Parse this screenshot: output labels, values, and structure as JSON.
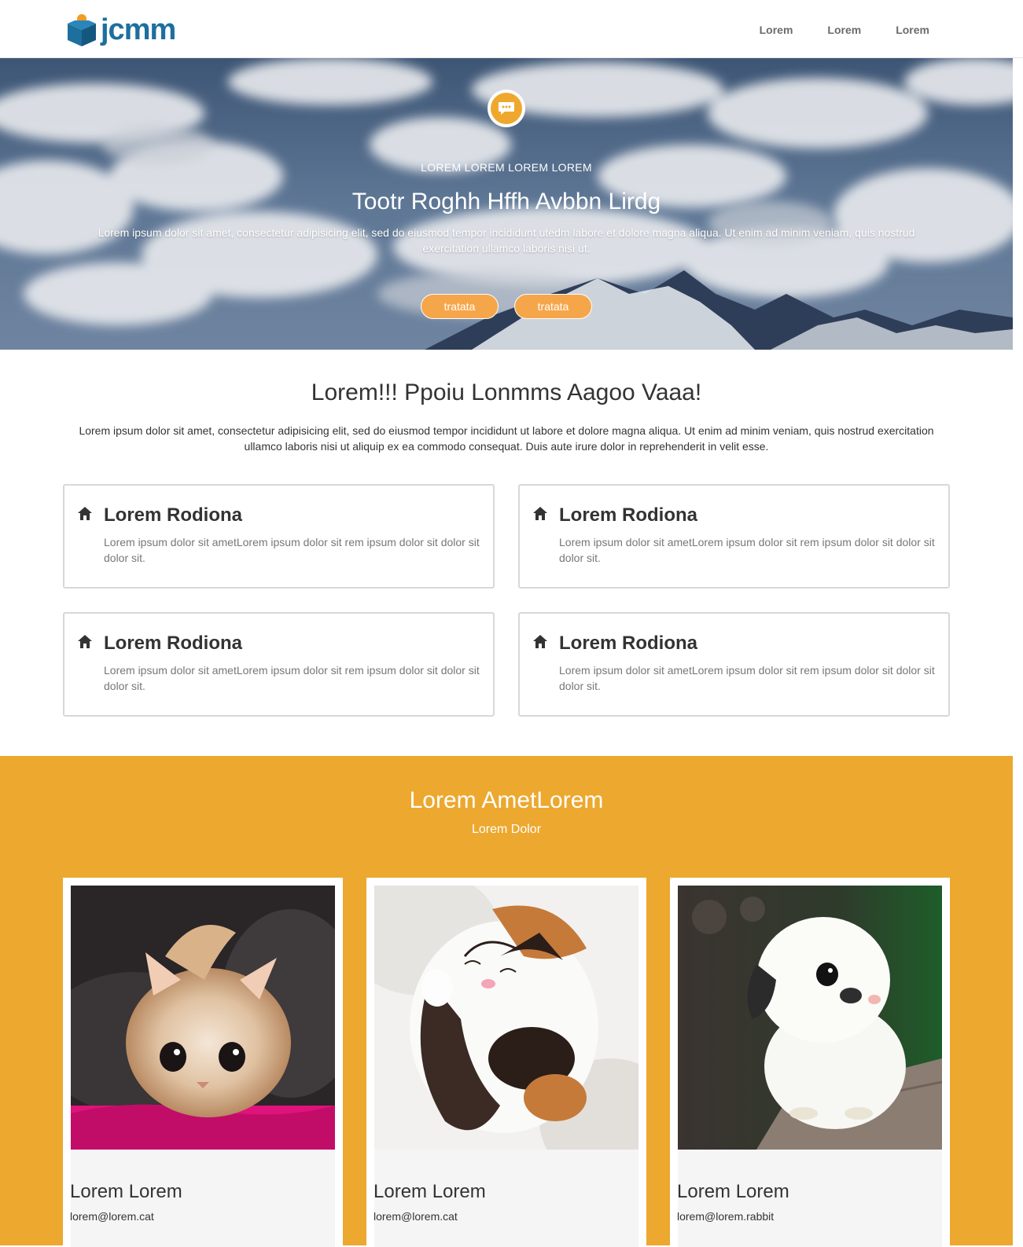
{
  "header": {
    "logo_text": "jcmm",
    "nav": [
      "Lorem",
      "Lorem",
      "Lorem"
    ]
  },
  "hero": {
    "kicker": "LOREM LOREM LOREM LOREM",
    "title": "Tootr Roghh Hffh Avbbn Lirdg",
    "text": "Lorem ipsum dolor sit amet, consectetur adipisicing elit, sed do eiusmod tempor incididunt utedm labore et dolore magna aliqua. Ut enim ad minim veniam, quis nostrud exercitation ullamco laboris nisi ut.",
    "buttons": [
      "tratata",
      "tratata"
    ],
    "icon": "chat-bubble-icon"
  },
  "intro": {
    "title": "Lorem!!! Ppoiu Lonmms Aagoo Vaaa!",
    "text": "Lorem ipsum dolor sit amet, consectetur adipisicing elit, sed do eiusmod tempor incididunt ut labore et dolore magna aliqua. Ut enim ad minim veniam, quis nostrud exercitation ullamco laboris nisi ut aliquip ex ea commodo consequat. Duis aute irure dolor in reprehenderit in velit esse."
  },
  "features": [
    {
      "title": "Lorem Rodiona",
      "text": "Lorem ipsum dolor sit ametLorem ipsum dolor sit rem ipsum dolor sit dolor sit dolor sit.",
      "icon": "home-icon"
    },
    {
      "title": "Lorem Rodiona",
      "text": "Lorem ipsum dolor sit ametLorem ipsum dolor sit rem ipsum dolor sit dolor sit dolor sit.",
      "icon": "home-icon"
    },
    {
      "title": "Lorem Rodiona",
      "text": "Lorem ipsum dolor sit ametLorem ipsum dolor sit rem ipsum dolor sit dolor sit dolor sit.",
      "icon": "home-icon"
    },
    {
      "title": "Lorem Rodiona",
      "text": "Lorem ipsum dolor sit ametLorem ipsum dolor sit rem ipsum dolor sit dolor sit dolor sit.",
      "icon": "home-icon"
    }
  ],
  "team": {
    "title": "Lorem AmetLorem",
    "subtitle": "Lorem Dolor",
    "members": [
      {
        "name": "Lorem Lorem",
        "email": "lorem@lorem.cat",
        "photo": "kitten-photo"
      },
      {
        "name": "Lorem Lorem",
        "email": "lorem@lorem.cat",
        "photo": "sleeping-kitten-photo"
      },
      {
        "name": "Lorem Lorem",
        "email": "lorem@lorem.rabbit",
        "photo": "bunny-photo"
      }
    ]
  },
  "colors": {
    "brand_blue": "#1d6f9e",
    "accent_orange": "#eca82f",
    "button_orange": "#f6a64a"
  }
}
